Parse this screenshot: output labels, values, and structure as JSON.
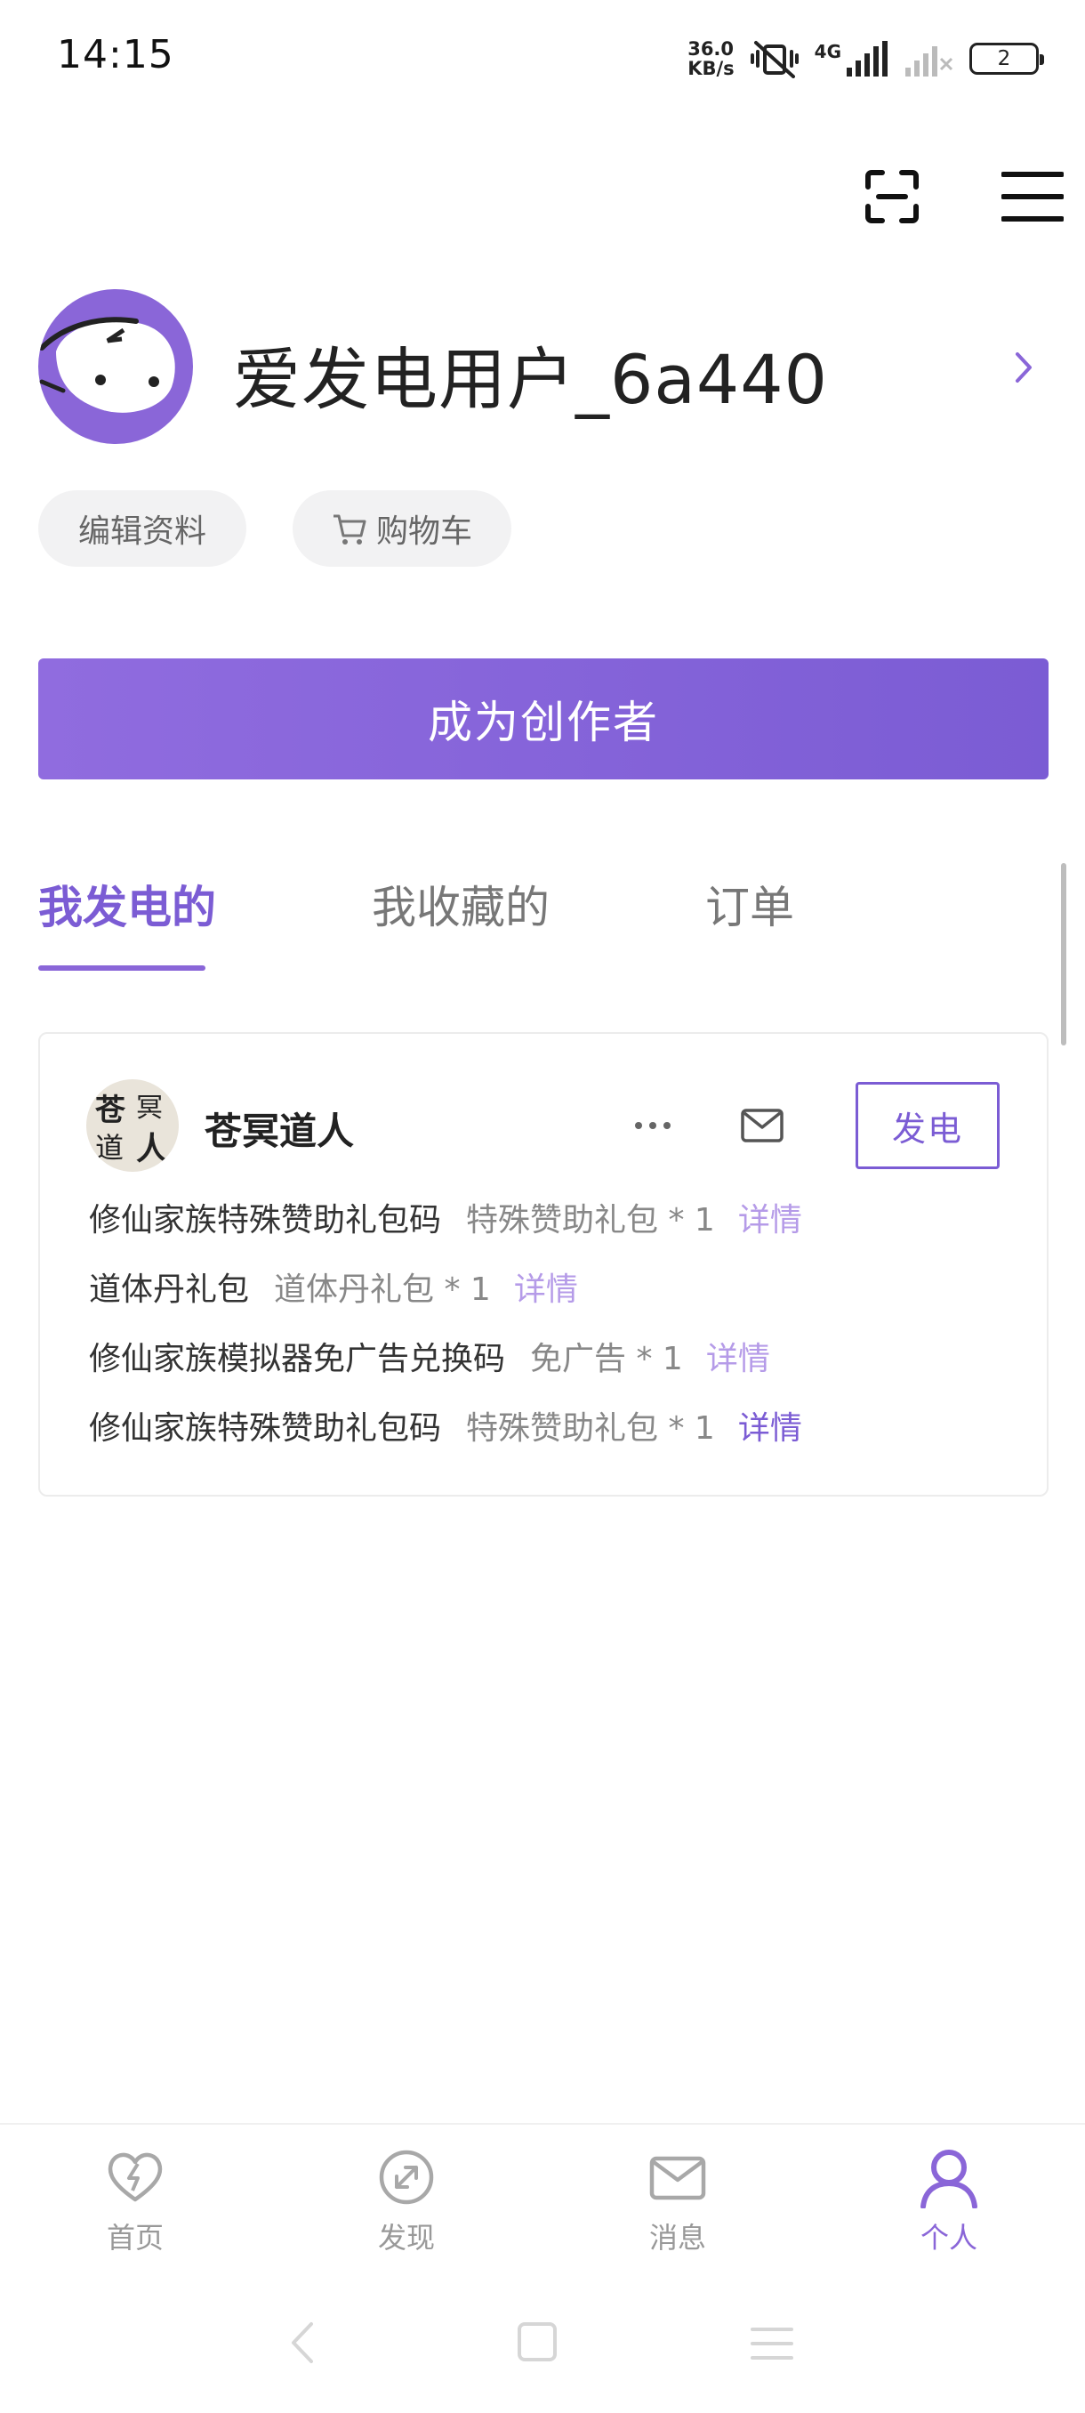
{
  "status_bar": {
    "time": "14:15",
    "net_speed_value": "36.0",
    "net_speed_unit": "KB/s",
    "network_type": "4G",
    "battery": "2"
  },
  "header": {
    "scan_icon": "scan-icon",
    "menu_icon": "menu-icon"
  },
  "profile": {
    "username": "爱发电用户_6a440",
    "edit_label": "编辑资料",
    "cart_label": "购物车",
    "become_creator_label": "成为创作者"
  },
  "tabs": [
    {
      "label": "我发电的",
      "active": true
    },
    {
      "label": "我收藏的",
      "active": false
    },
    {
      "label": "订单",
      "active": false
    }
  ],
  "creator_card": {
    "avatar_text": [
      "苍",
      "冥",
      "道",
      "人"
    ],
    "name": "苍冥道人",
    "power_button_label": "发电",
    "rewards": [
      {
        "name": "修仙家族特殊赞助礼包码",
        "item": "特殊赞助礼包 * 1",
        "detail": "详情"
      },
      {
        "name": "道体丹礼包",
        "item": "道体丹礼包 * 1",
        "detail": "详情"
      },
      {
        "name": "修仙家族模拟器免广告兑换码",
        "item": "免广告 * 1",
        "detail": "详情"
      },
      {
        "name": "修仙家族特殊赞助礼包码",
        "item": "特殊赞助礼包 * 1",
        "detail": "详情"
      }
    ]
  },
  "bottom_nav": [
    {
      "label": "首页",
      "icon": "heart-bolt-icon",
      "active": false
    },
    {
      "label": "发现",
      "icon": "compass-icon",
      "active": false
    },
    {
      "label": "消息",
      "icon": "mail-icon",
      "active": false
    },
    {
      "label": "个人",
      "icon": "person-icon",
      "active": true
    }
  ],
  "colors": {
    "accent": "#7b5cd4",
    "accent_light": "#8a66d8",
    "muted_link": "#b59be8",
    "pill_bg": "#f2f2f3"
  }
}
